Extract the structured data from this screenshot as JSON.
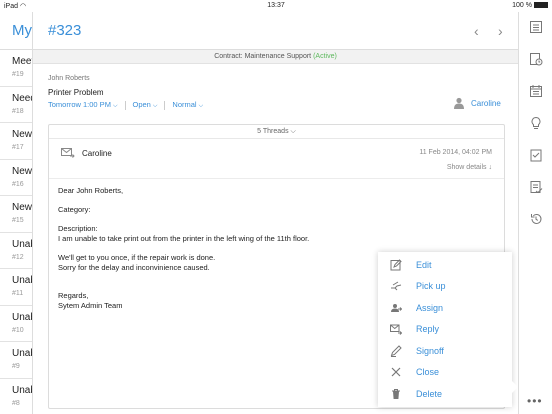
{
  "status_bar": {
    "device": "iPad",
    "time": "13:37",
    "battery": "100 %"
  },
  "list": {
    "title": "My",
    "items": [
      {
        "title": "Meet",
        "number": "#19"
      },
      {
        "title": "Need",
        "number": "#18"
      },
      {
        "title": "New",
        "number": "#17"
      },
      {
        "title": "New",
        "number": "#16"
      },
      {
        "title": "New",
        "number": "#15"
      },
      {
        "title": "Unab",
        "number": "#12"
      },
      {
        "title": "Unab",
        "number": "#11"
      },
      {
        "title": "Unab",
        "number": "#10"
      },
      {
        "title": "Unab",
        "number": "#9"
      },
      {
        "title": "Unab",
        "number": "#8"
      }
    ]
  },
  "ticket": {
    "id": "#323",
    "contract_label": "Contract:",
    "contract_name": "Maintenance Support",
    "contract_status": "(Active)",
    "requester": "John Roberts",
    "subject": "Printer Problem",
    "due": "Tomorrow 1:00 PM",
    "status": "Open",
    "priority": "Normal",
    "assignee": "Caroline"
  },
  "thread": {
    "count_label": "5 Threads",
    "sender": "Caroline",
    "date": "11 Feb 2014, 04:02 PM",
    "show_details": "Show details",
    "body": {
      "greeting": "Dear John Roberts,",
      "category": "Category:",
      "description_label": "Description:",
      "description": "I am unable to take print out from the printer in the left wing of the 11th floor.",
      "line1": "We'll get to you once, if the repair work is done.",
      "line2": "Sorry for the delay and inconvinience caused.",
      "regards": "Regards,",
      "signature": "Sytem Admin Team"
    }
  },
  "menu": {
    "items": [
      {
        "label": "Edit",
        "icon": "edit-icon"
      },
      {
        "label": "Pick up",
        "icon": "pickup-icon"
      },
      {
        "label": "Assign",
        "icon": "assign-icon"
      },
      {
        "label": "Reply",
        "icon": "reply-icon"
      },
      {
        "label": "Signoff",
        "icon": "signoff-icon"
      },
      {
        "label": "Close",
        "icon": "close-icon"
      },
      {
        "label": "Delete",
        "icon": "delete-icon"
      }
    ]
  },
  "toolbar": {
    "icons": [
      "details-icon",
      "time-log-icon",
      "calendar-icon",
      "solutions-icon",
      "tasks-icon",
      "checklist-icon",
      "history-icon"
    ],
    "more": "•••"
  },
  "colors": {
    "accent": "#3a8fd8",
    "active": "#5cb85c"
  }
}
